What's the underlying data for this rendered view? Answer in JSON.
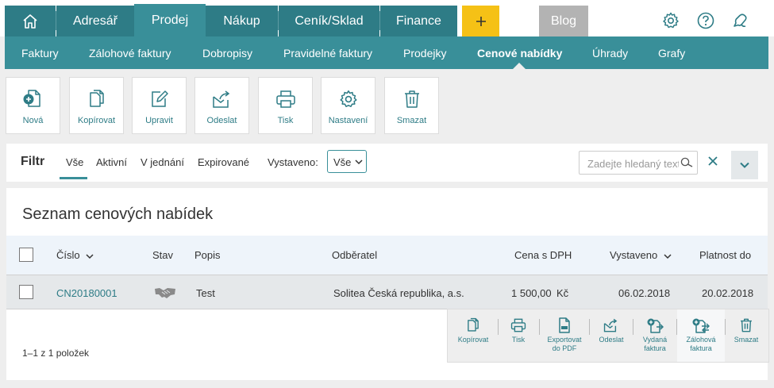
{
  "top_nav": {
    "home_icon": "home-icon",
    "items": [
      "Adresář",
      "Prodej",
      "Nákup",
      "Ceník/Sklad",
      "Finance"
    ],
    "active": "Prodej",
    "plus_label": "+",
    "blog_label": "Blog",
    "right_icons": [
      "gear-icon",
      "help-icon",
      "notifications-icon"
    ]
  },
  "sub_nav": {
    "items": [
      "Faktury",
      "Zálohové faktury",
      "Dobropisy",
      "Pravidelné faktury",
      "Prodejky",
      "Cenové nabídky",
      "Úhrady",
      "Grafy"
    ],
    "active": "Cenové nabídky"
  },
  "toolbar": {
    "buttons": [
      "Nová",
      "Kopírovat",
      "Upravit",
      "Odeslat",
      "Tisk",
      "Nastavení",
      "Smazat"
    ]
  },
  "filter": {
    "title": "Filtr",
    "tabs": [
      "Vše",
      "Aktivní",
      "V jednání",
      "Expirované"
    ],
    "active_tab": "Vše",
    "vystaveno_label": "Vystaveno:",
    "vystaveno_value": "Vše",
    "search_placeholder": "Zadejte hledaný text"
  },
  "list": {
    "title": "Seznam cenových nabídek",
    "columns": [
      "Číslo",
      "Stav",
      "Popis",
      "Odběratel",
      "Cena s DPH",
      "Vystaveno",
      "Platnost do"
    ],
    "rows": [
      {
        "cislo": "CN20180001",
        "stav_icon": "handshake-icon",
        "popis": "Test",
        "odberatel": "Solitea Česká republika, a.s.",
        "cena": "1 500,00",
        "mena": "Kč",
        "vystaveno": "06.02.2018",
        "platnost": "20.02.2018"
      }
    ],
    "count": "1–1 z 1 položek"
  },
  "row_actions": {
    "kopirovat": "Kopírovat",
    "tisk": "Tisk",
    "export_1": "Exportovat",
    "export_2": "do PDF",
    "odeslat": "Odeslat",
    "vydana_1": "Vydaná",
    "vydana_2": "faktura",
    "zalohova_1": "Zálohová",
    "zalohova_2": "faktura",
    "smazat": "Smazat"
  },
  "colors": {
    "nav_dark": "#2e7c86",
    "nav_active": "#398f99",
    "plus": "#f5c116",
    "blog": "#b3b3b3",
    "link": "#2e7c86"
  }
}
